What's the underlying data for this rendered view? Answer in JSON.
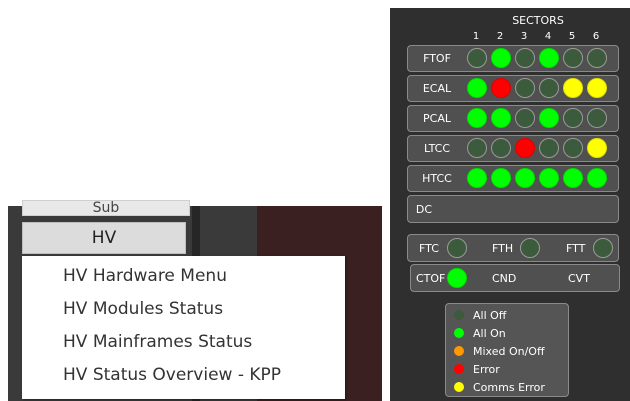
{
  "menu": {
    "top_button_label": "Sub",
    "hv_button_label": "HV",
    "items": [
      "HV Hardware Menu",
      "HV Modules Status",
      "HV Mainframes Status",
      "HV Status Overview - KPP"
    ]
  },
  "panel": {
    "title": "SECTORS",
    "columns": [
      "1",
      "2",
      "3",
      "4",
      "5",
      "6"
    ],
    "rows": [
      {
        "label": "FTOF",
        "states": [
          "off",
          "on",
          "off",
          "on",
          "off",
          "off"
        ]
      },
      {
        "label": "ECAL",
        "states": [
          "on",
          "err",
          "off",
          "off",
          "comms",
          "comms"
        ]
      },
      {
        "label": "PCAL",
        "states": [
          "on",
          "on",
          "off",
          "on",
          "off",
          "off"
        ]
      },
      {
        "label": "LTCC",
        "states": [
          "off",
          "off",
          "err",
          "off",
          "off",
          "comms"
        ]
      },
      {
        "label": "HTCC",
        "states": [
          "on",
          "on",
          "on",
          "on",
          "on",
          "on"
        ]
      },
      {
        "label": "DC",
        "states": []
      }
    ],
    "forward": [
      {
        "label": "FTC",
        "state": "off"
      },
      {
        "label": "FTH",
        "state": "off"
      },
      {
        "label": "FTT",
        "state": "off"
      }
    ],
    "central": [
      {
        "label": "CTOF",
        "state": "on"
      },
      {
        "label": "CND"
      },
      {
        "label": "CVT"
      }
    ],
    "legend": [
      {
        "label": "All Off",
        "color": "#3c5a3c"
      },
      {
        "label": "All On",
        "color": "#00ff00"
      },
      {
        "label": "Mixed On/Off",
        "color": "#ff9900"
      },
      {
        "label": "Error",
        "color": "#ff0000"
      },
      {
        "label": "Comms Error",
        "color": "#ffff00"
      }
    ]
  }
}
